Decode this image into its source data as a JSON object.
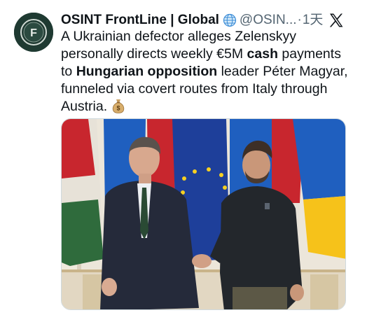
{
  "tweet": {
    "author_name": "OSINT FrontLine | Global",
    "handle": "@OSIN...",
    "dot": "·",
    "time": "1天",
    "avatar_letter": "F",
    "icons": {
      "verified": "globe-icon",
      "platform": "x-logo-icon",
      "emoji": "money-bag-icon"
    },
    "text": {
      "part1": "A Ukrainian defector alleges Zelenskyy personally directs weekly €5M ",
      "bold1": "cash",
      "part2": " payments to ",
      "bold2": "Hungarian opposition",
      "part3": " leader Péter Magyar, funneled via covert routes from Italy through Austria."
    }
  },
  "colors": {
    "text": "#0f1419",
    "secondary": "#536471",
    "avatar_bg": "#1f3a32",
    "ukraine_blue": "#1f5fbf",
    "ukraine_yellow": "#f6c21a",
    "eu_blue": "#1e3f9a",
    "hungary_red": "#c8262e",
    "hungary_green": "#2f6b3c"
  }
}
